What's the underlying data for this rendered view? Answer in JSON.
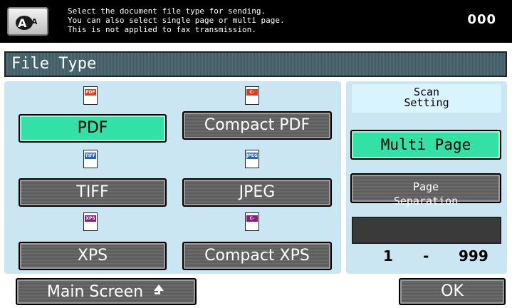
{
  "header": {
    "message_lines": [
      "Select the document file type for sending.",
      "You can also select single page or multi page.",
      "This is not applied to fax transmission."
    ],
    "counter": "000",
    "accessibility_icon": "enlarge-display-icon"
  },
  "title": "File Type",
  "file_types": [
    {
      "label": "PDF",
      "icon_tag": "PDF",
      "tag_color": "#e03b1f",
      "selected": true
    },
    {
      "label": "Compact PDF",
      "icon_tag": "C-PDF",
      "tag_color": "#e03b1f",
      "selected": false
    },
    {
      "label": "TIFF",
      "icon_tag": "TIFF",
      "tag_color": "#1f66c8",
      "selected": false
    },
    {
      "label": "JPEG",
      "icon_tag": "JPEG",
      "tag_color": "#1f66c8",
      "selected": false
    },
    {
      "label": "XPS",
      "icon_tag": "XPS",
      "tag_color": "#8a1a8a",
      "selected": false
    },
    {
      "label": "Compact XPS",
      "icon_tag": "C-XPS",
      "tag_color": "#8a1a8a",
      "selected": false
    }
  ],
  "scan_setting": {
    "label_line1": "Scan",
    "label_line2": "Setting",
    "multi_page_label": "Multi Page",
    "page_separation_line1": "Page",
    "page_separation_line2": "Separation",
    "range_from": "1",
    "range_dash": "-",
    "range_to": "999"
  },
  "footer": {
    "main_screen_label": "Main Screen",
    "main_screen_icon": "up-arrow-icon",
    "ok_label": "OK"
  },
  "colors": {
    "selected": "#33e0a6",
    "panel": "#c9e6f2",
    "header_bg": "#000000"
  }
}
